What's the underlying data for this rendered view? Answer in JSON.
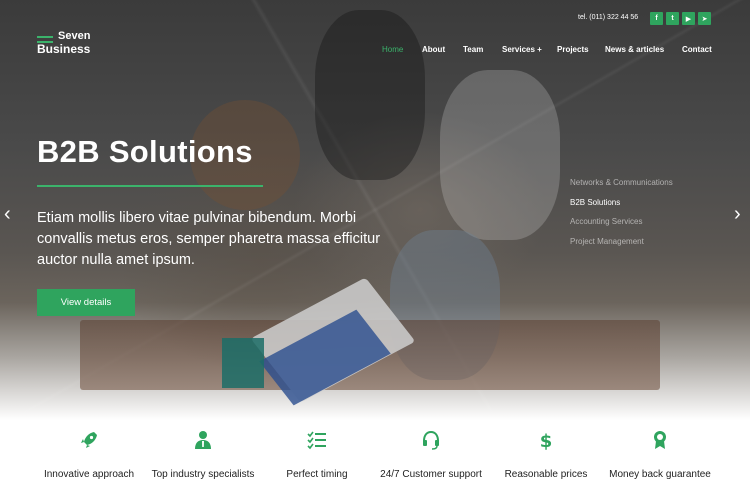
{
  "header": {
    "logo_line1": "Seven",
    "logo_line2": "Business",
    "phone": "tel. (011) 322 44 56",
    "social": [
      {
        "icon": "facebook-icon",
        "glyph": "f"
      },
      {
        "icon": "twitter-icon",
        "glyph": "t"
      },
      {
        "icon": "youtube-icon",
        "glyph": "▶"
      },
      {
        "icon": "telegram-icon",
        "glyph": "➤"
      }
    ],
    "nav": [
      {
        "label": "Home",
        "active": true
      },
      {
        "label": "About",
        "active": false
      },
      {
        "label": "Team",
        "active": false
      },
      {
        "label": "Services +",
        "active": false
      },
      {
        "label": "Projects",
        "active": false
      },
      {
        "label": "News & articles",
        "active": false
      },
      {
        "label": "Contact",
        "active": false
      }
    ]
  },
  "hero": {
    "title": "B2B Solutions",
    "description": "Etiam mollis libero vitae pulvinar bibendum. Morbi convallis metus eros, semper pharetra massa efficitur auctor nulla amet ipsum.",
    "cta": "View details",
    "slides": [
      {
        "label": "Networks & Communications",
        "active": false
      },
      {
        "label": "B2B Solutions",
        "active": true
      },
      {
        "label": "Accounting Services",
        "active": false
      },
      {
        "label": "Project Management",
        "active": false
      }
    ],
    "arrow_prev": "‹",
    "arrow_next": "›"
  },
  "features": [
    {
      "icon": "rocket-icon",
      "label": "Innovative approach"
    },
    {
      "icon": "specialist-icon",
      "label": "Top industry specialists"
    },
    {
      "icon": "checklist-icon",
      "label": "Perfect timing"
    },
    {
      "icon": "headset-icon",
      "label": "24/7 Customer support"
    },
    {
      "icon": "dollar-icon",
      "label": "Reasonable prices"
    },
    {
      "icon": "award-icon",
      "label": "Money back guarantee"
    }
  ],
  "colors": {
    "accent": "#2fa45e"
  }
}
